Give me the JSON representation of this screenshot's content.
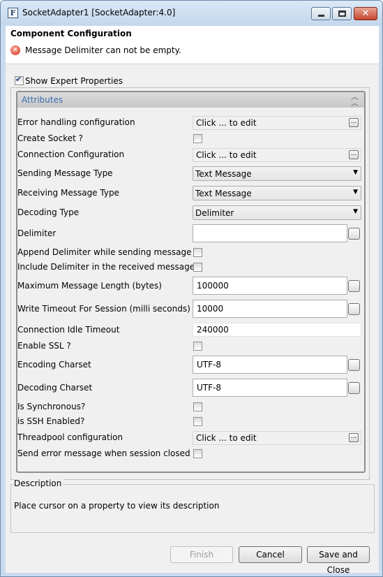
{
  "window": {
    "title": "SocketAdapter1 [SocketAdapter:4.0]",
    "app_icon_glyph": "F"
  },
  "header": {
    "title": "Component Configuration",
    "error": "Message Delimiter can not be empty."
  },
  "expert": {
    "label": "Show Expert Properties",
    "checked": true
  },
  "section": {
    "title": "Attributes"
  },
  "props": {
    "error_handling": {
      "label": "Error handling configuration",
      "value": "Click ... to edit"
    },
    "create_socket": {
      "label": "Create Socket ?"
    },
    "connection_config": {
      "label": "Connection Configuration",
      "value": "Click ... to edit"
    },
    "sending_type": {
      "label": "Sending Message Type",
      "value": "Text Message"
    },
    "receiving_type": {
      "label": "Receiving Message Type",
      "value": "Text Message"
    },
    "decoding_type": {
      "label": "Decoding Type",
      "value": "Delimiter"
    },
    "delimiter": {
      "label": "Delimiter",
      "value": ""
    },
    "append_delim": {
      "label": "Append Delimiter while sending message"
    },
    "include_delim": {
      "label": "Include Delimiter in the received message"
    },
    "max_len": {
      "label": "Maximum Message Length (bytes)",
      "value": "100000"
    },
    "write_timeout": {
      "label": "Write Timeout For Session (milli seconds)",
      "value": "10000"
    },
    "idle_timeout": {
      "label": "Connection Idle Timeout",
      "value": "240000"
    },
    "enable_ssl": {
      "label": "Enable SSL ?"
    },
    "encoding": {
      "label": "Encoding Charset",
      "value": "UTF-8"
    },
    "decoding": {
      "label": "Decoding Charset",
      "value": "UTF-8"
    },
    "synchronous": {
      "label": "Is Synchronous?"
    },
    "ssh": {
      "label": "is SSH Enabled?"
    },
    "threadpool": {
      "label": "Threadpool configuration",
      "value": "Click ... to edit"
    },
    "send_error": {
      "label": "Send error message when session closed ?"
    }
  },
  "ellipsis": "...",
  "description": {
    "title": "Description",
    "text": "Place cursor on a property to view its description"
  },
  "buttons": {
    "finish": "Finish",
    "cancel": "Cancel",
    "save_close": "Save and Close"
  },
  "colors": {
    "accent": "#3a6fb0",
    "window_frame": "#c9dcef",
    "close_button": "#c7462d"
  }
}
